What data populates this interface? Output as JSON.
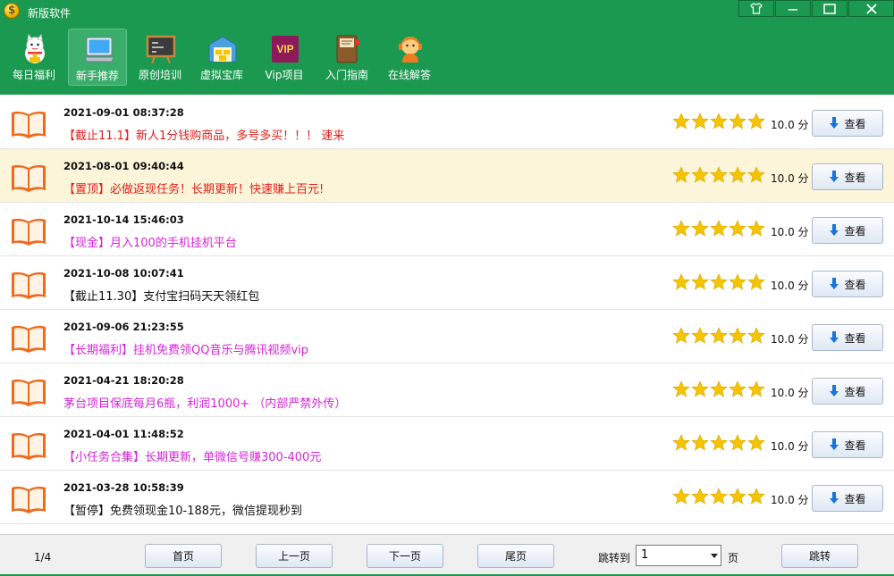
{
  "app": {
    "title": "新版软件"
  },
  "toolbar": {
    "items": [
      {
        "label": "每日福利",
        "icon": "lucky-cat-icon"
      },
      {
        "label": "新手推荐",
        "icon": "laptop-icon",
        "active": true
      },
      {
        "label": "原创培训",
        "icon": "blackboard-icon"
      },
      {
        "label": "虚拟宝库",
        "icon": "treasure-warehouse-icon"
      },
      {
        "label": "Vip项目",
        "icon": "vip-icon"
      },
      {
        "label": "入门指南",
        "icon": "guide-book-icon"
      },
      {
        "label": "在线解答",
        "icon": "support-agent-icon"
      }
    ]
  },
  "list": {
    "view_label": "查看",
    "score_suffix": "分",
    "rows": [
      {
        "date": "2021-09-01 08:37:28",
        "title": "【截止11.1】新人1分钱购商品，多号多买！！！ 速来",
        "color": "#e0201c",
        "score": "10.0",
        "stars": 5
      },
      {
        "date": "2021-08-01 09:40:44",
        "title": "【置顶】必做返现任务！长期更新！快速赚上百元!",
        "color": "#e0201c",
        "score": "10.0",
        "stars": 5
      },
      {
        "date": "2021-10-14 15:46:03",
        "title": "【现金】月入100的手机挂机平台",
        "color": "#d524d8",
        "score": "10.0",
        "stars": 5
      },
      {
        "date": "2021-10-08 10:07:41",
        "title": "【截止11.30】支付宝扫码天天领红包",
        "color": "#111111",
        "score": "10.0",
        "stars": 5
      },
      {
        "date": "2021-09-06 21:23:55",
        "title": "【长期福利】挂机免费领QQ音乐与腾讯视频vip",
        "color": "#d524d8",
        "score": "10.0",
        "stars": 5
      },
      {
        "date": "2021-04-21 18:20:28",
        "title": "茅台项目保底每月6瓶，利润1000+ （内部严禁外传）",
        "color": "#d524d8",
        "score": "10.0",
        "stars": 5
      },
      {
        "date": "2021-04-01 11:48:52",
        "title": "【小任务合集】长期更新，单微信号赚300-400元",
        "color": "#d524d8",
        "score": "10.0",
        "stars": 5
      },
      {
        "date": "2021-03-28 10:58:39",
        "title": "【暂停】免费领现金10-188元，微信提现秒到",
        "color": "#111111",
        "score": "10.0",
        "stars": 5
      }
    ]
  },
  "pagination": {
    "page_info": "1/4",
    "first": "首页",
    "prev": "上一页",
    "next": "下一页",
    "last": "尾页",
    "jump_to": "跳转到",
    "jump_value": "1",
    "unit": "页",
    "go": "跳转"
  },
  "colors": {
    "brand_green": "#1c9950",
    "highlight_row": "#fdf5d9",
    "star": "#f5c400"
  }
}
